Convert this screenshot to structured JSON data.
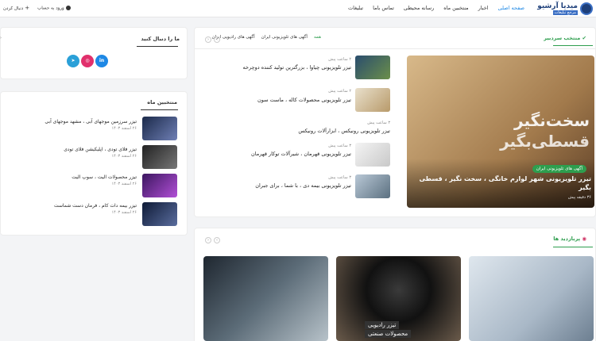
{
  "header": {
    "logo_text": "میدیا آرشیو",
    "logo_sub": "مرجع تبلیغات",
    "nav": [
      "صفحه اصلی",
      "اخبار",
      "منتخبین ماه",
      "رسانه محیطی",
      "تماس باما",
      "تبلیغات"
    ],
    "login": "ورود به حساب",
    "follow": "دنبال کردن"
  },
  "featured": {
    "section_title": "منتخب سردبیر",
    "tabs": [
      "همه",
      "آگهی های تلویزیونی ایران",
      "آگهی های رادیویی ایران"
    ],
    "hero": {
      "image_text_1": "سخت‌نگیر",
      "image_text_2": "قسطی‌بگیر",
      "badge": "آگهی های تلویزیونی ایران",
      "title": "تیزر تلویزیونی شهر لوازم خانگی ، سخت نگیر ، قسطی بگیر",
      "time": "۳۶ دقیقه پیش"
    },
    "items": [
      {
        "time": "۲ ساعت پیش",
        "title": "تیزر تلویزیونی چیاوا ، بزرگترین تولید کننده دوچرخه"
      },
      {
        "time": "۲ ساعت پیش",
        "title": "تیزر تلویزیونی محصولات کاله ، ماست سون"
      },
      {
        "time": "۳ ساعت پیش",
        "title": "تیزر تلویزیونی رونیکس ، ابزارآلات رونیکس"
      },
      {
        "time": "۳ ساعت پیش",
        "title": "تیزر تلویزیونی قهرمان ، شیرآلات توکار قهرمان"
      },
      {
        "time": "۳ ساعت پیش",
        "title": "تیزر تلویزیونی بیمه دی ، با شما ، برای جبران"
      }
    ]
  },
  "sidebar": {
    "follow_title": "ما را دنبال کنید",
    "socials": [
      {
        "label": "in",
        "color": "#1e88e5"
      },
      {
        "label": "◎",
        "color": "#e1306c"
      },
      {
        "label": "➤",
        "color": "#2aa0d8"
      }
    ],
    "month_title": "منتخبین ماه",
    "items": [
      {
        "title": "تیزر سرزمین موجهای آبی ، مشهد موجهای آبی",
        "date": "۲۶ اسفند ۱۴۰۳"
      },
      {
        "title": "تیزر فلای تودی ، اپلیکیشن فلای تودی",
        "date": "۲۶ اسفند ۱۴۰۳"
      },
      {
        "title": "تیزر محصولات الیت ، سوپ الیت",
        "date": "۲۶ اسفند ۱۴۰۳"
      },
      {
        "title": "تیزر بیمه دات کام ، فرمان دست شماست",
        "date": "۲۶ اسفند ۱۴۰۳"
      }
    ]
  },
  "popular": {
    "section_title": "پربازدید ها",
    "card2_line1": "تیزر رادیویی",
    "card2_line2": "محصولات صنعتی"
  }
}
